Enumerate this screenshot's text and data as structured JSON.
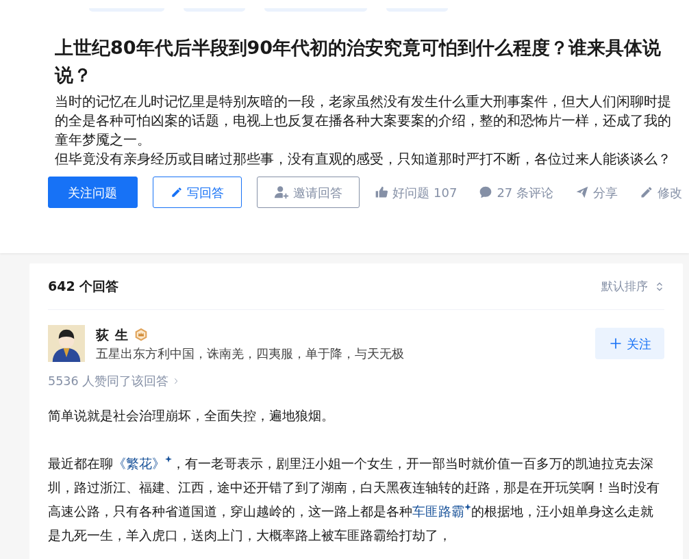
{
  "question": {
    "title": "上世纪80年代后半段到90年代初的治安究竟可怕到什么程度？谁来具体说说？",
    "description": [
      "当时的记忆在儿时记忆里是特别灰暗的一段，老家虽然没有发生什么重大刑事案件，但大人们闲聊时提的全是各种可怕凶案的话题，电视上也反复在播各种大案要案的介绍，整的和恐怖片一样，还成了我的童年梦魇之一。",
      "但毕竟没有亲身经历或目睹过那些事，没有直观的感受，只知道那时严打不断，各位过来人能谈谈么？"
    ],
    "actions": [
      {
        "kind": "primary",
        "label": "关注问题"
      },
      {
        "kind": "write",
        "label": "写回答"
      },
      {
        "kind": "invite",
        "label": "邀请回答"
      }
    ],
    "meta": [
      {
        "kind": "like",
        "label": "好问题 107"
      },
      {
        "kind": "comment",
        "label": "27 条评论"
      },
      {
        "kind": "share",
        "label": "分享"
      },
      {
        "kind": "edit",
        "label": "修改"
      }
    ]
  },
  "answers": {
    "count": "642 个回答",
    "sort": "默认排序",
    "author": {
      "name": "荻 生",
      "bio": "五星出东方利中国，诛南羌，四夷服，单于降，与天无极",
      "follow": "关注"
    },
    "upvotes": "5536 人赞同了该回答",
    "paragraphs": [
      {
        "parts": [
          {
            "text": "简单说就是社会治理崩坏，全面失控，遍地狼烟。"
          }
        ]
      },
      {
        "parts": [
          {
            "text": "最近都在聊"
          },
          {
            "text": "《繁花》",
            "link": true
          },
          {
            "text": "，有一老哥表示，剧里汪小姐一个女生，开一部当时就价值一百多万的凯迪拉克去深圳，路过浙江、福建、江西，途中还开错了到了湖南，白天黑夜连轴转的赶路，那是在开玩笑啊！当时没有高速公路，只有各种省道国道，穿山越岭的，这一路上都是各种"
          },
          {
            "text": "车匪路霸",
            "link": true
          },
          {
            "text": "的根据地，汪小姐单身这么走就是九死一生，羊入虎口，送肉上门，大概率路上被车匪路霸给打劫了，"
          }
        ]
      }
    ]
  }
}
